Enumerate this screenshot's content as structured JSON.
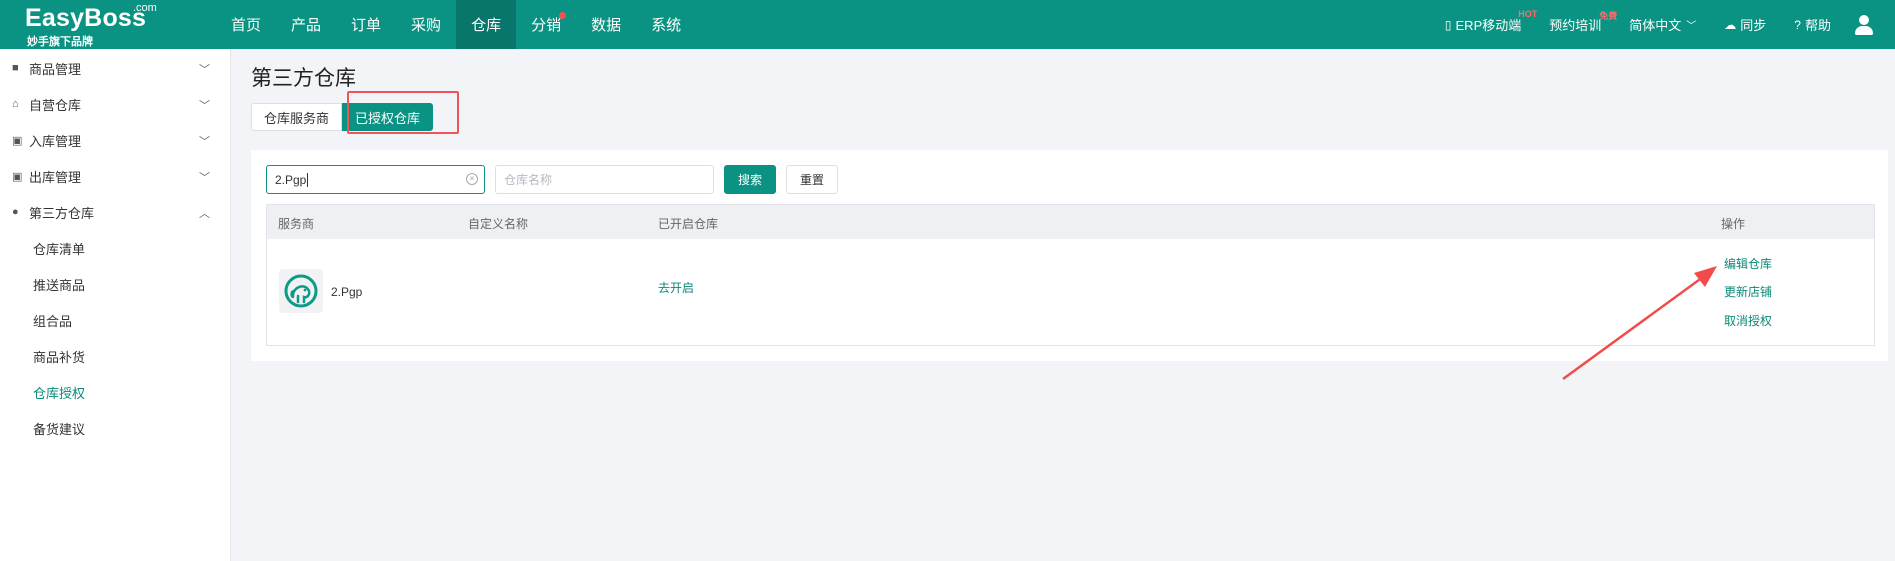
{
  "brand": {
    "name": "EasyBoss",
    "com": ".com",
    "tagline": "妙手旗下品牌",
    "color": "#0a9383"
  },
  "nav": {
    "items": [
      {
        "label": "首页"
      },
      {
        "label": "产品"
      },
      {
        "label": "订单"
      },
      {
        "label": "采购"
      },
      {
        "label": "仓库",
        "active": true
      },
      {
        "label": "分销",
        "dot": true
      },
      {
        "label": "数据"
      },
      {
        "label": "系统"
      }
    ]
  },
  "topRight": {
    "erp": "ERP移动端",
    "erp_badge": "HOT",
    "training": "预约培训",
    "training_badge": "免费",
    "language": "简体中文",
    "sync": "同步",
    "help": "帮助"
  },
  "sidebar": {
    "groups": [
      {
        "label": "商品管理",
        "icon": "product-icon"
      },
      {
        "label": "自营仓库",
        "icon": "home-icon"
      },
      {
        "label": "入库管理",
        "icon": "inbox-icon"
      },
      {
        "label": "出库管理",
        "icon": "outbox-icon"
      },
      {
        "label": "第三方仓库",
        "icon": "warehouse-icon",
        "expanded": true
      }
    ],
    "subItems": [
      {
        "label": "仓库清单"
      },
      {
        "label": "推送商品"
      },
      {
        "label": "组合品"
      },
      {
        "label": "商品补货"
      },
      {
        "label": "仓库授权",
        "active": true
      },
      {
        "label": "备货建议"
      }
    ]
  },
  "page": {
    "title": "第三方仓库",
    "tabs": [
      {
        "label": "仓库服务商"
      },
      {
        "label": "已授权仓库",
        "active": true
      }
    ]
  },
  "filters": {
    "provider_value": "2.Pgp",
    "warehouse_placeholder": "仓库名称",
    "search_label": "搜索",
    "reset_label": "重置"
  },
  "table": {
    "columns": {
      "provider": "服务商",
      "custom_name": "自定义名称",
      "enabled": "已开启仓库",
      "actions": "操作"
    },
    "rows": [
      {
        "provider": "2.Pgp",
        "custom_name": "",
        "enabled_link": "去开启",
        "actions": [
          "编辑仓库",
          "更新店铺",
          "取消授权"
        ]
      }
    ]
  }
}
